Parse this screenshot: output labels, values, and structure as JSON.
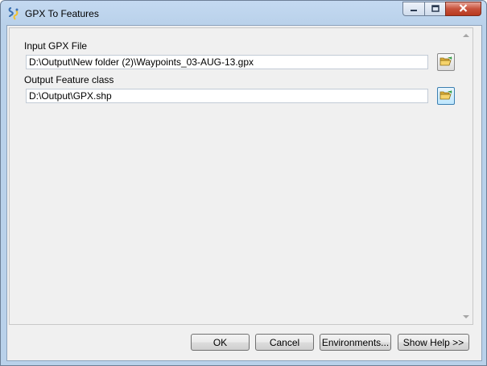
{
  "window": {
    "title": "GPX To Features",
    "icon": "python-script-icon",
    "controls": [
      "minimize-icon",
      "maximize-icon",
      "close-icon"
    ]
  },
  "form": {
    "input_gpx": {
      "label": "Input GPX File",
      "value": "D:\\Output\\New folder (2)\\Waypoints_03-AUG-13.gpx",
      "browse_icon": "open-folder-icon"
    },
    "output_fc": {
      "label": "Output Feature class",
      "value": "D:\\Output\\GPX.shp",
      "browse_icon": "open-folder-icon"
    }
  },
  "buttons": {
    "ok": "OK",
    "cancel": "Cancel",
    "environments": "Environments...",
    "show_help": "Show Help >>"
  },
  "colors": {
    "title_bar": "#c4d9f1",
    "close_button": "#c7513b",
    "dialog_face": "#f0f0f0",
    "folder_icon": "#f2c94c"
  }
}
